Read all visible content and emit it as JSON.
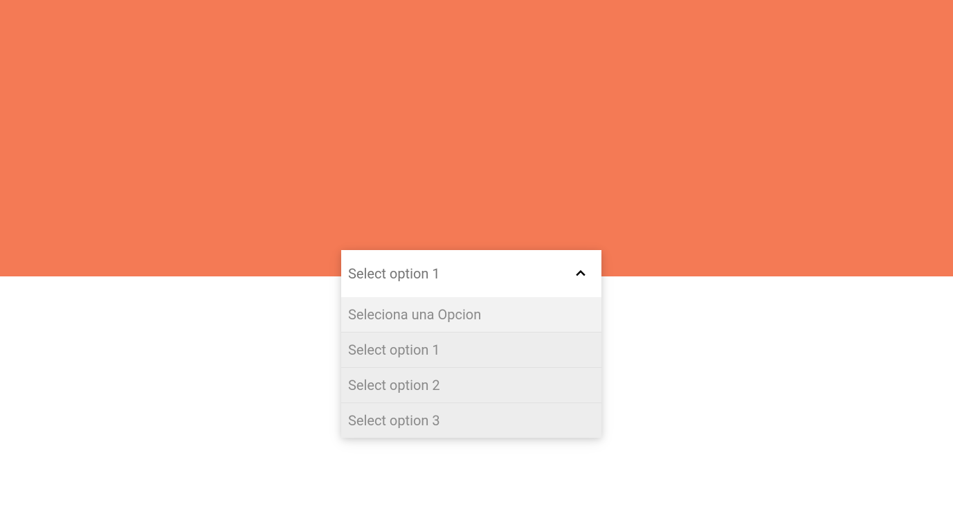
{
  "select": {
    "selected_label": "Select option 1",
    "options": [
      {
        "label": "Seleciona una Opcion"
      },
      {
        "label": "Select option 1"
      },
      {
        "label": "Select option 2"
      },
      {
        "label": "Select option 3"
      }
    ]
  }
}
